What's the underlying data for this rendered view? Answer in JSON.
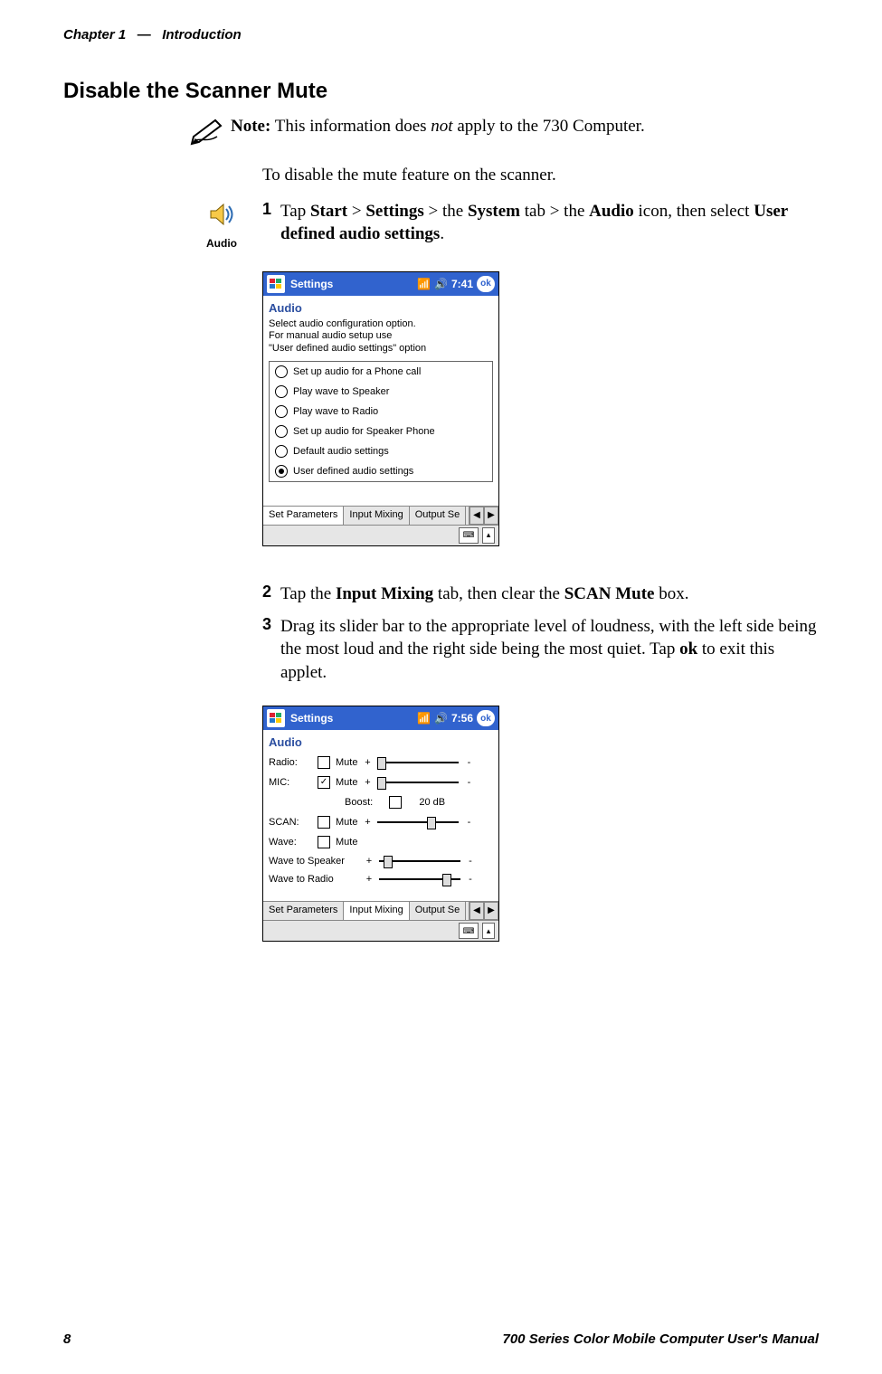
{
  "header": {
    "chapter": "Chapter 1",
    "sep": "—",
    "title": "Introduction"
  },
  "section_heading": "Disable the Scanner Mute",
  "note": {
    "lead": "Note:",
    "before_ital": " This information does ",
    "ital": "not",
    "after_ital": " apply to the 730 Computer."
  },
  "intro": "To disable the mute feature on the scanner.",
  "audio_icon_caption": "Audio",
  "steps": {
    "s1": {
      "num": "1",
      "t1": "Tap ",
      "b1": "Start",
      "t2": " > ",
      "b2": "Settings",
      "t3": " > the ",
      "b3": "System",
      "t4": " tab > the ",
      "b4": "Audio",
      "t5": " icon, then select ",
      "b5": "User defined audio settings",
      "t6": "."
    },
    "s2": {
      "num": "2",
      "t1": "Tap the ",
      "b1": "Input Mixing",
      "t2": " tab, then clear the ",
      "b2": "SCAN Mute",
      "t3": " box."
    },
    "s3": {
      "num": "3",
      "t1": "Drag its slider bar to the appropriate level of loudness, with the left side being the most loud and the right side being the most quiet. Tap ",
      "b1": "ok",
      "t2": " to exit this applet."
    }
  },
  "shot1": {
    "titlebar": {
      "title": "Settings",
      "time": "7:41",
      "ok": "ok"
    },
    "app_title": "Audio",
    "instr_l1": "Select audio configuration option.",
    "instr_l2": "For manual audio setup use",
    "instr_l3": "\"User defined audio settings\" option",
    "radios": {
      "r0": "Set up audio for a Phone call",
      "r1": "Play wave to Speaker",
      "r2": "Play wave to Radio",
      "r3": "Set up audio for Speaker Phone",
      "r4": "Default audio settings",
      "r5": "User defined audio settings"
    },
    "tabs": {
      "t0": "Set Parameters",
      "t1": "Input Mixing",
      "t2": "Output Se"
    }
  },
  "shot2": {
    "titlebar": {
      "title": "Settings",
      "time": "7:56",
      "ok": "ok"
    },
    "app_title": "Audio",
    "rows": {
      "radio": {
        "label": "Radio:",
        "mute": "Mute"
      },
      "mic": {
        "label": "MIC:",
        "mute": "Mute",
        "boost_lbl": "Boost:",
        "boost_val": "20 dB"
      },
      "scan": {
        "label": "SCAN:",
        "mute": "Mute"
      },
      "wave": {
        "label": "Wave:",
        "mute": "Mute"
      },
      "wts": {
        "label": "Wave to Speaker"
      },
      "wtr": {
        "label": "Wave to Radio"
      }
    },
    "tabs": {
      "t0": "Set Parameters",
      "t1": "Input Mixing",
      "t2": "Output Se"
    }
  },
  "footer": {
    "page": "8",
    "manual": "700 Series Color Mobile Computer User's Manual"
  }
}
